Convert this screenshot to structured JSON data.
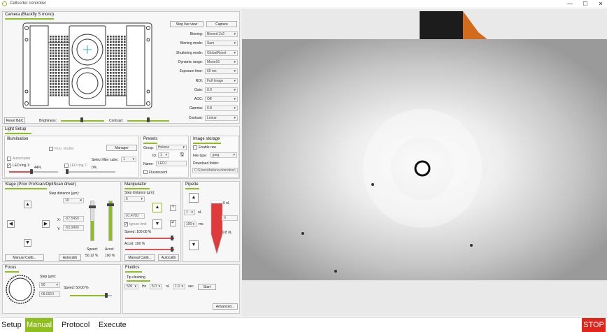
{
  "window": {
    "title": "Cellsorter controller",
    "min": "—",
    "max": "☐",
    "close": "✕"
  },
  "camera": {
    "title": "Camera (Blackfly S mono)",
    "stop_live": "Stop live view",
    "capture": "Capture",
    "reset_bc": "Reset B&C",
    "brightness": "Brightness:",
    "contrast": "Contrast:",
    "settings": [
      {
        "label": "Binning:",
        "value": "Binned 2x2"
      },
      {
        "label": "Binning mode:",
        "value": "Sum"
      },
      {
        "label": "Shuttering mode:",
        "value": "GlobalReset"
      },
      {
        "label": "Dynamic range:",
        "value": "Mono16"
      },
      {
        "label": "Exposure time:",
        "value": "60 ms"
      },
      {
        "label": "ROI:",
        "value": "Full Image"
      },
      {
        "label": "Gain:",
        "value": "0.0"
      },
      {
        "label": "AGC:",
        "value": "Off"
      },
      {
        "label": "Gamma:",
        "value": "0.8"
      },
      {
        "label": "Contrast:",
        "value": "Linear"
      }
    ]
  },
  "light": {
    "title": "Light Setup",
    "illumination": "Illumination",
    "fluo_shutter": "Fluo. shutter",
    "manager": "Manager",
    "autoshutter": "Autoshutter",
    "select_filter": "Select filter cube:",
    "filter_value": "1",
    "led1": "LED ring 1:",
    "led1_pct": "44%",
    "led2": "LED ring 2:",
    "led2_pct": "0%"
  },
  "presets": {
    "title": "Presets",
    "group_lbl": "Group:",
    "group": "Helena",
    "id_lbl": "ID:",
    "id": "1",
    "name_lbl": "Name:",
    "name": "LED1",
    "fluorescent": "Fluorescent"
  },
  "storage": {
    "title": "Image storage",
    "enable_raw": "Enable raw",
    "file_type_lbl": "File type:",
    "file_type": "jpeg",
    "download_lbl": "Download folder:",
    "download": "C:\\Users\\helena.domokos\\"
  },
  "stage": {
    "title": "Stage (Prior ProScan/OptiScan driver)",
    "step_lbl": "Step distance (µm):",
    "step": "10",
    "x_lbl": "X:",
    "x": "-57.5450",
    "y_lbl": "Y:",
    "y": "-55.9400",
    "speed_lbl": "Speed:",
    "speed": "50.12 %",
    "accel_lbl": "Accel:",
    "accel": "100 %",
    "manual": "Manual Calib...",
    "auto": "Autocalib"
  },
  "manip": {
    "title": "Manipulator",
    "step_lbl": "Step distance (µm):",
    "step": "5",
    "z": "01.4700",
    "ignore": "Ignore limit",
    "speed": "Speed: 100.00 %",
    "accel": "Accel: 100 %",
    "manual": "Manual Calib...",
    "auto": "Autocalib"
  },
  "pipette": {
    "title": "Pipette",
    "vol": "1",
    "vol_unit": "nL",
    "rate": "100",
    "rate_unit": "ms",
    "top_lbl": "0 nL",
    "bottom_lbl": "9.8 nL",
    "field": "0"
  },
  "focus": {
    "title": "Focus",
    "step_lbl": "Step (µm):",
    "step": "50",
    "pos": "08.0910",
    "speed": "Speed: 50.00 %"
  },
  "fluidics": {
    "title": "Fluidics",
    "tip": "Tip cleaning",
    "v1": "500",
    "u1": "Hz",
    "v2": "5.0",
    "u2": "nL",
    "v3": "1.0",
    "u3": "sec.",
    "start": "Start",
    "advanced": "Advanced..."
  },
  "tabs": [
    {
      "label": "Setup",
      "active": false
    },
    {
      "label": "Manual",
      "active": true
    },
    {
      "label": "Protocol",
      "active": false
    },
    {
      "label": "Execute",
      "active": false
    }
  ],
  "stop": "STOP",
  "colors": {
    "accent": "#8dbf1e",
    "stop": "#e0261b"
  }
}
